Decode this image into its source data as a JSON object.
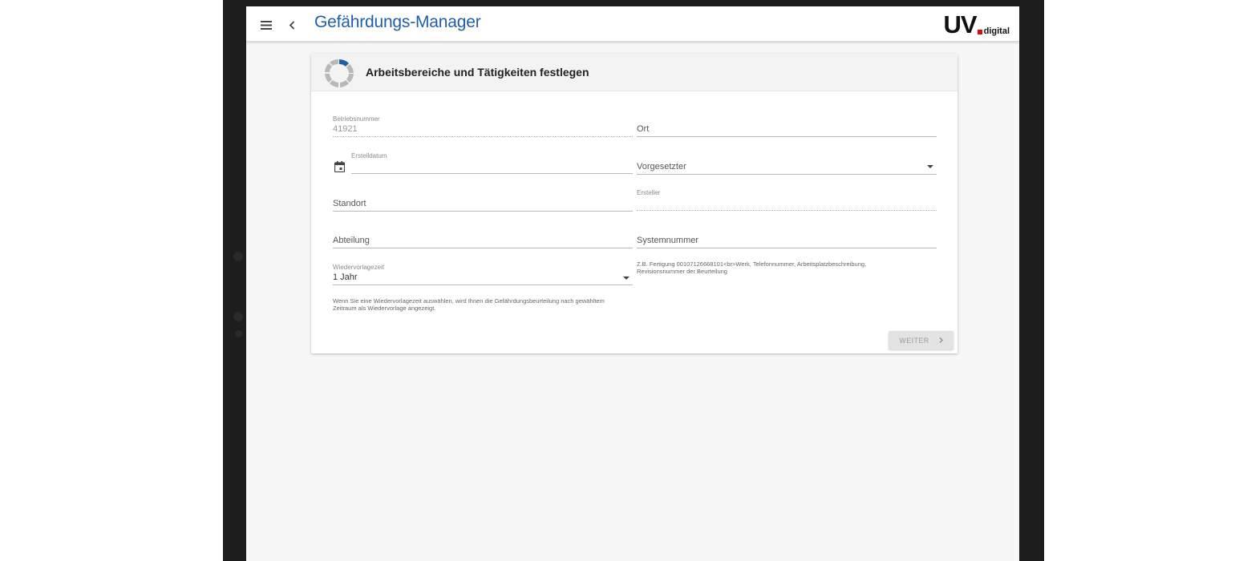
{
  "appbar": {
    "title": "Gefährdungs-Manager",
    "logo_main": "UV",
    "logo_sub": "digital",
    "menu_icon": "menu-icon",
    "back_icon": "chevron-left-icon"
  },
  "card": {
    "title": "Arbeitsbereiche und Tätigkeiten festlegen",
    "progress_icon": "progress-ring-icon"
  },
  "form": {
    "betriebsnummer": {
      "label": "Betriebsnummer",
      "value": "41921"
    },
    "ort": {
      "placeholder": "Ort"
    },
    "erstelldatum": {
      "label": "Erstelldatum",
      "value": ""
    },
    "vorgesetzter": {
      "placeholder": "Vorgesetzter"
    },
    "standort": {
      "placeholder": "Standort"
    },
    "ersteller": {
      "label": "Ersteller",
      "value": ""
    },
    "abteilung": {
      "placeholder": "Abteilung"
    },
    "systemnummer": {
      "placeholder": "Systemnummer",
      "hint_line1": "Z.B. Fertigung 00107126668101<br>Werk, Telefonnummer, Arbeitsplatzbeschreibung,",
      "hint_line2": "Revisionsnummer der Beurteilung"
    },
    "wiedervorlagezeit": {
      "label": "Wiedervorlagezeit",
      "value": "1 Jahr",
      "hint_line1": "Wenn Sie eine Wiedervorlagezeit auswählen, wird Ihnen die Gefährdungsbeurteilung nach gewähltem",
      "hint_line2": "Zeitraum als Wiedervorlage angezeigt."
    }
  },
  "actions": {
    "next_label": "WEITER"
  },
  "colors": {
    "title": "#1f5ea8",
    "logo_dot": "#e30613",
    "spinner_active": "#1f5ea8"
  }
}
